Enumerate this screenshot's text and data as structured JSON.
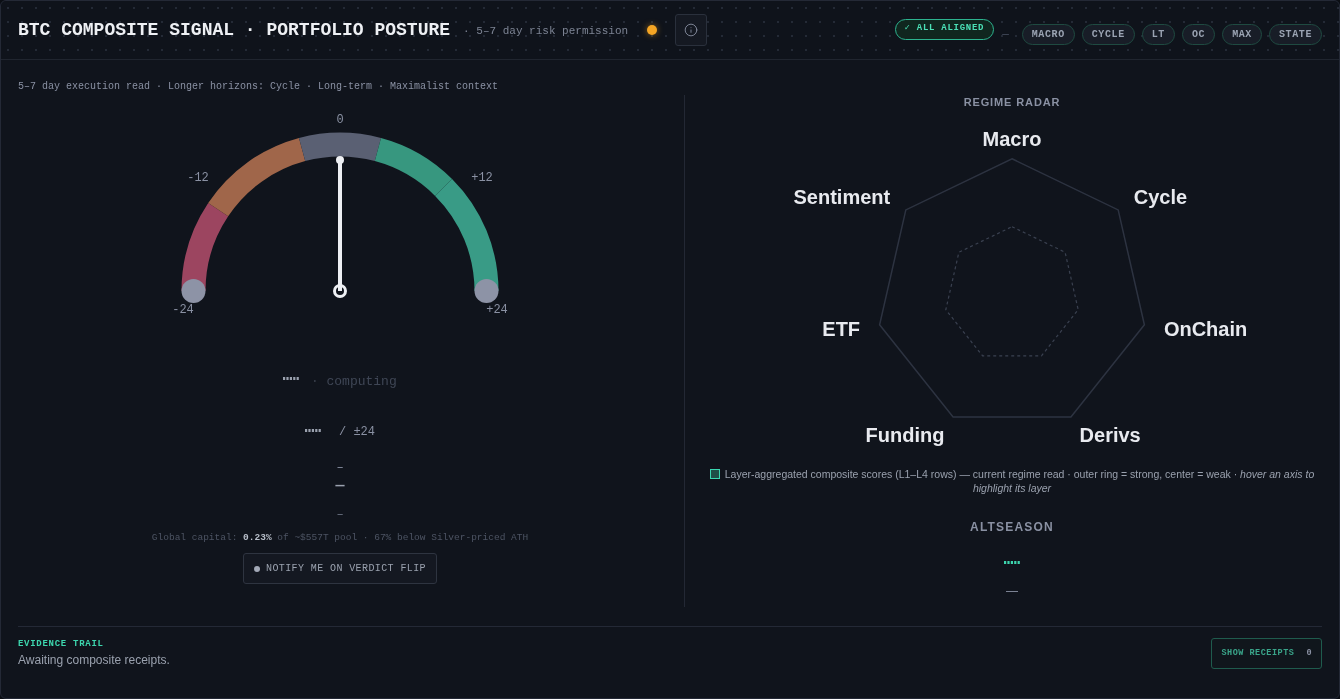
{
  "header": {
    "title": "BTC COMPOSITE SIGNAL · PORTFOLIO POSTURE",
    "subtitle": "· 5–7 day risk permission",
    "alignment_badge": "✓ ALL ALIGNED",
    "separator": "—",
    "layers": [
      "MACRO",
      "CYCLE",
      "LT",
      "OC",
      "MAX",
      "STATE"
    ]
  },
  "execution": {
    "caption": "5–7 day execution read · Longer horizons: Cycle · Long-term · Maximalist context",
    "gauge": {
      "ticks": [
        "-24",
        "-12",
        "0",
        "+12",
        "+24"
      ],
      "zones": [
        {
          "color": "#9c4560"
        },
        {
          "color": "#a0664a"
        },
        {
          "color": "#5a6073"
        },
        {
          "color": "#37977f"
        },
        {
          "color": "#399b86"
        }
      ],
      "level": 0.5
    },
    "status": {
      "separator": "·",
      "label": "computing"
    },
    "score_range": "/ ±24",
    "placeholders": [
      "–",
      "—",
      "–"
    ],
    "global_capital": "Global capital: **0.23%** of ~$557T pool · 67% below Silver-priced ATH",
    "notify_button": "NOTIFY ME ON VERDICT FLIP"
  },
  "radar": {
    "title": "REGIME RADAR",
    "axes": [
      {
        "label": "Macro"
      },
      {
        "label": "Sentiment"
      },
      {
        "label": "Cycle"
      },
      {
        "label": "ETF"
      },
      {
        "label": "OnChain"
      },
      {
        "label": "Funding"
      },
      {
        "label": "Derivs"
      }
    ],
    "legend": "Layer-aggregated composite scores (L1–L4 rows) — current regime read · outer ring = strong, center = weak · *hover an axis to highlight its layer*"
  },
  "altseason": {
    "title": "ALTSEASON",
    "value": "—"
  },
  "evidence": {
    "title": "EVIDENCE TRAIL",
    "message": "Awaiting composite receipts.",
    "button": {
      "label": "SHOW RECEIPTS",
      "count": "0"
    }
  }
}
